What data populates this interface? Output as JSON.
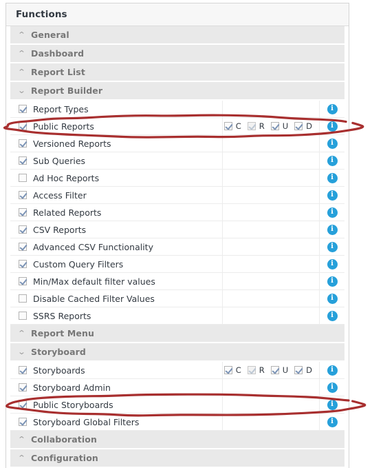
{
  "panel": {
    "title": "Functions"
  },
  "colors": {
    "accent_info": "#26a0da",
    "annotation_red": "#a82f2f",
    "group_header_bg": "#e9e9e9",
    "panel_header_bg": "#f7f7f7",
    "text_primary": "#333a42",
    "text_group": "#777777"
  },
  "icons": {
    "chevron_collapsed": "⌃",
    "chevron_expanded": "⌄",
    "info_glyph": "i"
  },
  "crud_labels": {
    "c": "C",
    "r": "R",
    "u": "U",
    "d": "D"
  },
  "rows": [
    {
      "kind": "group",
      "label": "General",
      "expanded": false
    },
    {
      "kind": "group",
      "label": "Dashboard",
      "expanded": false
    },
    {
      "kind": "group",
      "label": "Report List",
      "expanded": false
    },
    {
      "kind": "group",
      "label": "Report Builder",
      "expanded": true
    },
    {
      "kind": "item",
      "label": "Report Types",
      "checked": true,
      "crud": null
    },
    {
      "kind": "item",
      "label": "Public Reports",
      "checked": true,
      "crud": {
        "c": true,
        "r": true,
        "r_disabled": true,
        "u": true,
        "d": true
      }
    },
    {
      "kind": "item",
      "label": "Versioned Reports",
      "checked": true,
      "crud": null
    },
    {
      "kind": "item",
      "label": "Sub Queries",
      "checked": true,
      "crud": null
    },
    {
      "kind": "item",
      "label": "Ad Hoc Reports",
      "checked": false,
      "crud": null
    },
    {
      "kind": "item",
      "label": "Access Filter",
      "checked": true,
      "crud": null
    },
    {
      "kind": "item",
      "label": "Related Reports",
      "checked": true,
      "crud": null
    },
    {
      "kind": "item",
      "label": "CSV Reports",
      "checked": true,
      "crud": null
    },
    {
      "kind": "item",
      "label": "Advanced CSV Functionality",
      "checked": true,
      "crud": null
    },
    {
      "kind": "item",
      "label": "Custom Query Filters",
      "checked": true,
      "crud": null
    },
    {
      "kind": "item",
      "label": "Min/Max default filter values",
      "checked": true,
      "crud": null
    },
    {
      "kind": "item",
      "label": "Disable Cached Filter Values",
      "checked": false,
      "crud": null
    },
    {
      "kind": "item",
      "label": "SSRS Reports",
      "checked": false,
      "crud": null
    },
    {
      "kind": "group",
      "label": "Report Menu",
      "expanded": false
    },
    {
      "kind": "group",
      "label": "Storyboard",
      "expanded": true
    },
    {
      "kind": "item",
      "label": "Storyboards",
      "checked": true,
      "crud": {
        "c": true,
        "r": true,
        "r_disabled": true,
        "u": true,
        "d": true
      }
    },
    {
      "kind": "item",
      "label": "Storyboard Admin",
      "checked": true,
      "crud": null
    },
    {
      "kind": "item",
      "label": "Public Storyboards",
      "checked": true,
      "crud": null
    },
    {
      "kind": "item",
      "label": "Storyboard Global Filters",
      "checked": true,
      "crud": null
    },
    {
      "kind": "group",
      "label": "Collaboration",
      "expanded": false
    },
    {
      "kind": "group",
      "label": "Configuration",
      "expanded": false
    }
  ],
  "annotations": [
    {
      "name": "highlight-public-reports",
      "target_label": "Public Reports"
    },
    {
      "name": "highlight-public-storyboards",
      "target_label": "Public Storyboards"
    }
  ]
}
